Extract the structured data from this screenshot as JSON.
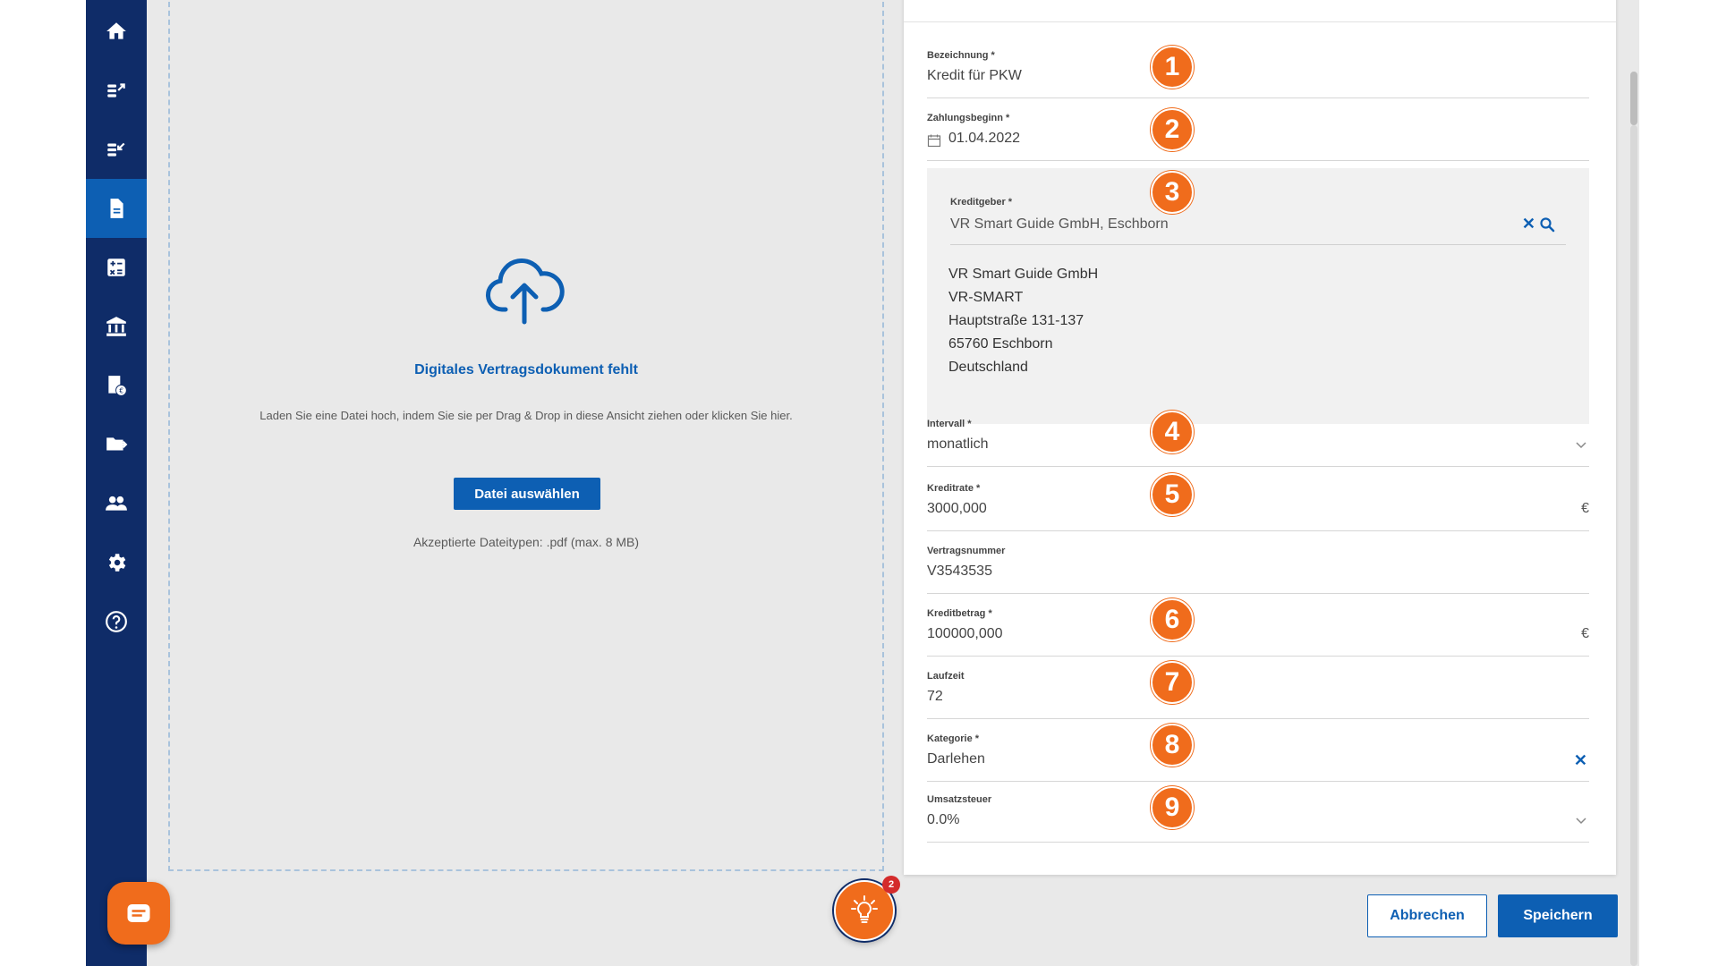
{
  "sidebar": {
    "items": [
      {
        "icon": "home-icon",
        "label": ""
      },
      {
        "icon": "coins-out-icon",
        "label": ""
      },
      {
        "icon": "coins-in-icon",
        "label": ""
      },
      {
        "icon": "document-icon",
        "label": "",
        "active": true
      },
      {
        "icon": "calculator-icon",
        "label": ""
      },
      {
        "icon": "bank-icon",
        "label": ""
      },
      {
        "icon": "receipt-icon",
        "label": ""
      },
      {
        "icon": "folder-export-icon",
        "label": ""
      },
      {
        "icon": "people-icon",
        "label": ""
      },
      {
        "icon": "gear-icon",
        "label": ""
      },
      {
        "icon": "help-icon",
        "label": ""
      }
    ]
  },
  "dropzone": {
    "title": "Digitales Vertragsdokument fehlt",
    "text": "Laden Sie eine Datei hoch, indem Sie sie per Drag & Drop in diese Ansicht ziehen oder klicken Sie hier.",
    "button": "Datei auswählen",
    "accepted": "Akzeptierte Dateitypen: .pdf (max. 8 MB)"
  },
  "tips": {
    "badge": "2"
  },
  "form": {
    "bezeichnung": {
      "label": "Bezeichnung *",
      "value": "Kredit für PKW"
    },
    "zahlungsbeginn": {
      "label": "Zahlungsbeginn *",
      "value": "01.04.2022"
    },
    "kreditgeber": {
      "label": "Kreditgeber *",
      "value": "VR Smart Guide GmbH, Eschborn",
      "address": [
        "VR Smart Guide GmbH",
        "VR-SMART",
        "Hauptstraße 131-137",
        "65760 Eschborn",
        "Deutschland"
      ]
    },
    "intervall": {
      "label": "Intervall *",
      "value": "monatlich"
    },
    "kreditrate": {
      "label": "Kreditrate *",
      "value": "3000,000",
      "unit": "€"
    },
    "vertragsnummer": {
      "label": "Vertragsnummer",
      "value": "V3543535"
    },
    "kreditbetrag": {
      "label": "Kreditbetrag *",
      "value": "100000,000",
      "unit": "€"
    },
    "laufzeit": {
      "label": "Laufzeit",
      "value": "72"
    },
    "kategorie": {
      "label": "Kategorie *",
      "value": "Darlehen"
    },
    "umsatzsteuer": {
      "label": "Umsatzsteuer",
      "value": "0.0%"
    }
  },
  "steps": [
    "1",
    "2",
    "3",
    "4",
    "5",
    "6",
    "7",
    "8",
    "9"
  ],
  "actions": {
    "cancel": "Abbrechen",
    "save": "Speichern"
  },
  "colors": {
    "sidebar": "#0f2c68",
    "primary": "#0d5fb3",
    "accent": "#f06c1c"
  }
}
